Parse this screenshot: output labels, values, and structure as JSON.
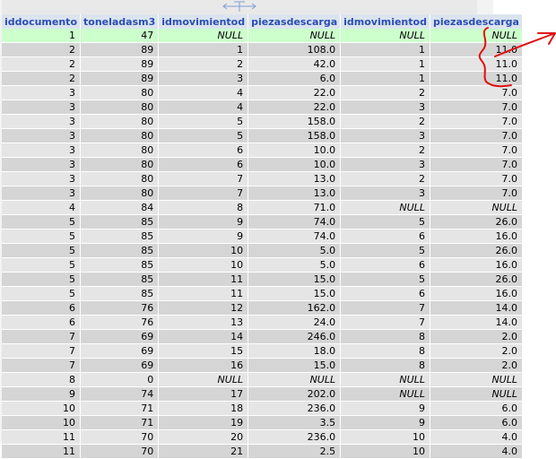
{
  "table": {
    "columns": [
      "iddocumento",
      "toneladasm3",
      "idmovimientod",
      "piezasdescarga",
      "idmovimientod",
      "piezasdescarga"
    ],
    "rows": [
      [
        "1",
        "47",
        "NULL",
        "NULL",
        "NULL",
        "NULL"
      ],
      [
        "2",
        "89",
        "1",
        "108.0",
        "1",
        "11.0"
      ],
      [
        "2",
        "89",
        "2",
        "42.0",
        "1",
        "11.0"
      ],
      [
        "2",
        "89",
        "3",
        "6.0",
        "1",
        "11.0"
      ],
      [
        "3",
        "80",
        "4",
        "22.0",
        "2",
        "7.0"
      ],
      [
        "3",
        "80",
        "4",
        "22.0",
        "3",
        "7.0"
      ],
      [
        "3",
        "80",
        "5",
        "158.0",
        "2",
        "7.0"
      ],
      [
        "3",
        "80",
        "5",
        "158.0",
        "3",
        "7.0"
      ],
      [
        "3",
        "80",
        "6",
        "10.0",
        "2",
        "7.0"
      ],
      [
        "3",
        "80",
        "6",
        "10.0",
        "3",
        "7.0"
      ],
      [
        "3",
        "80",
        "7",
        "13.0",
        "2",
        "7.0"
      ],
      [
        "3",
        "80",
        "7",
        "13.0",
        "3",
        "7.0"
      ],
      [
        "4",
        "84",
        "8",
        "71.0",
        "NULL",
        "NULL"
      ],
      [
        "5",
        "85",
        "9",
        "74.0",
        "5",
        "26.0"
      ],
      [
        "5",
        "85",
        "9",
        "74.0",
        "6",
        "16.0"
      ],
      [
        "5",
        "85",
        "10",
        "5.0",
        "5",
        "26.0"
      ],
      [
        "5",
        "85",
        "10",
        "5.0",
        "6",
        "16.0"
      ],
      [
        "5",
        "85",
        "11",
        "15.0",
        "5",
        "26.0"
      ],
      [
        "5",
        "85",
        "11",
        "15.0",
        "6",
        "16.0"
      ],
      [
        "6",
        "76",
        "12",
        "162.0",
        "7",
        "14.0"
      ],
      [
        "6",
        "76",
        "13",
        "24.0",
        "7",
        "14.0"
      ],
      [
        "7",
        "69",
        "14",
        "246.0",
        "8",
        "2.0"
      ],
      [
        "7",
        "69",
        "15",
        "18.0",
        "8",
        "2.0"
      ],
      [
        "7",
        "69",
        "16",
        "15.0",
        "8",
        "2.0"
      ],
      [
        "8",
        "0",
        "NULL",
        "NULL",
        "NULL",
        "NULL"
      ],
      [
        "9",
        "74",
        "17",
        "202.0",
        "NULL",
        "NULL"
      ],
      [
        "10",
        "71",
        "18",
        "236.0",
        "9",
        "6.0"
      ],
      [
        "10",
        "71",
        "19",
        "3.5",
        "9",
        "6.0"
      ],
      [
        "11",
        "70",
        "20",
        "236.0",
        "10",
        "4.0"
      ],
      [
        "11",
        "70",
        "21",
        "2.5",
        "10",
        "4.0"
      ]
    ],
    "selected_row": 0
  },
  "colors": {
    "header_text": "#2a4eb4",
    "header_bg": "#dbe4ee",
    "row_odd": "#e5e5e5",
    "row_even": "#d5d5d5",
    "selected_row": "#ccffcc",
    "annotation": "#e01010"
  },
  "icons": {
    "resize_handle": "column-resize-icon",
    "annotation_arrow": "red-arrow-annotation",
    "annotation_brace": "red-brace-annotation"
  }
}
